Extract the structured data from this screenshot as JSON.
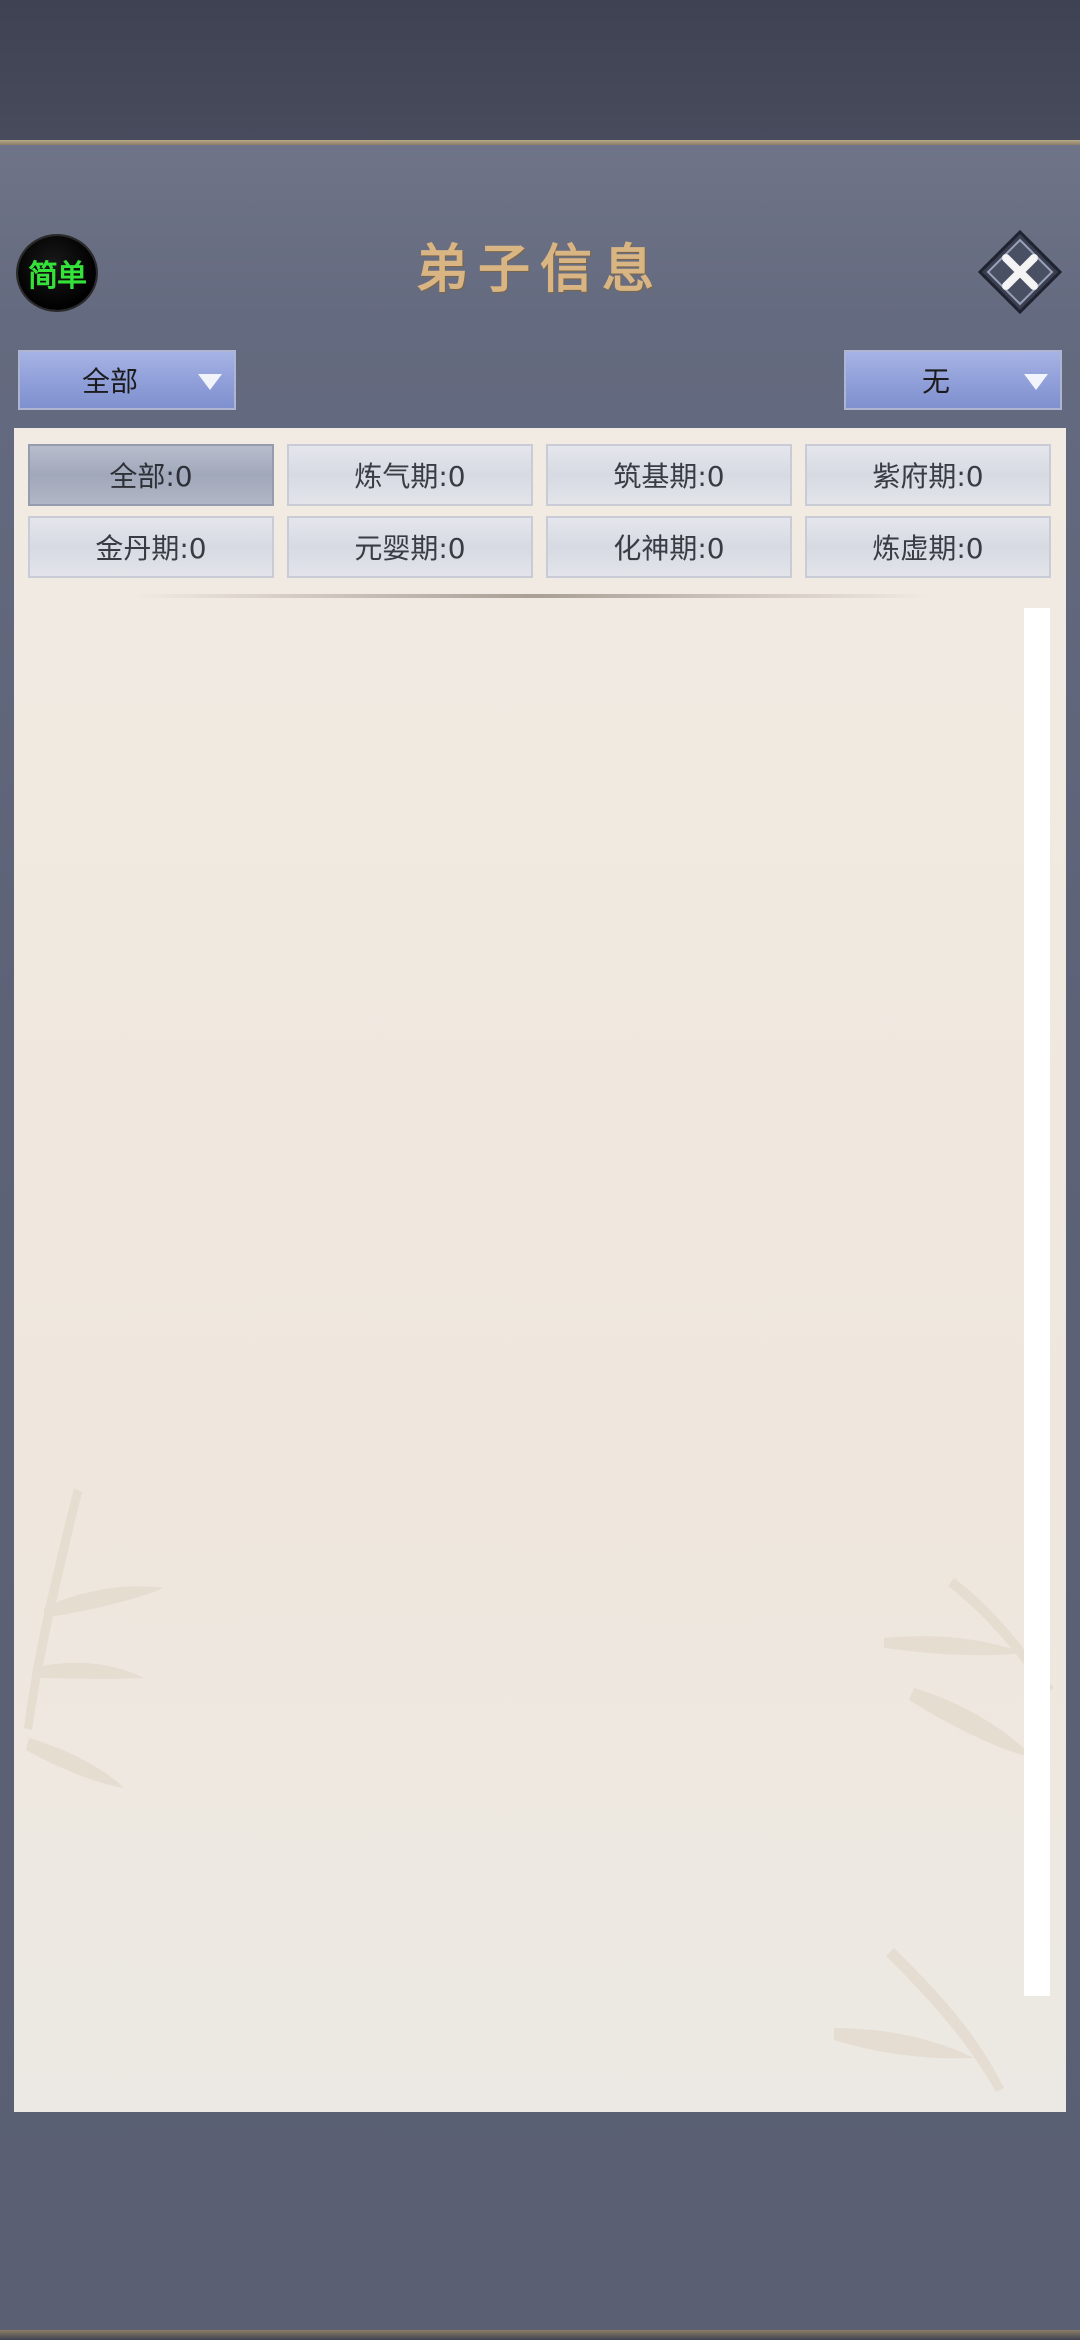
{
  "header": {
    "simple_label": "简单",
    "title": "弟子信息"
  },
  "filter_dropdown": {
    "value": "全部"
  },
  "sort_dropdown": {
    "value": "无"
  },
  "tabs": [
    {
      "label": "全部:0",
      "active": true
    },
    {
      "label": "炼气期:0",
      "active": false
    },
    {
      "label": "筑基期:0",
      "active": false
    },
    {
      "label": "紫府期:0",
      "active": false
    },
    {
      "label": "金丹期:0",
      "active": false
    },
    {
      "label": "元婴期:0",
      "active": false
    },
    {
      "label": "化神期:0",
      "active": false
    },
    {
      "label": "炼虚期:0",
      "active": false
    }
  ],
  "colors": {
    "panel": "#5d6277",
    "title": "#d9b583",
    "simple_label": "#35e23a",
    "content_bg": "#f1ebe3",
    "dropdown": "#93a2db"
  },
  "icons": {
    "close": "close-icon",
    "dropdown_arrow": "chevron-down-icon"
  }
}
